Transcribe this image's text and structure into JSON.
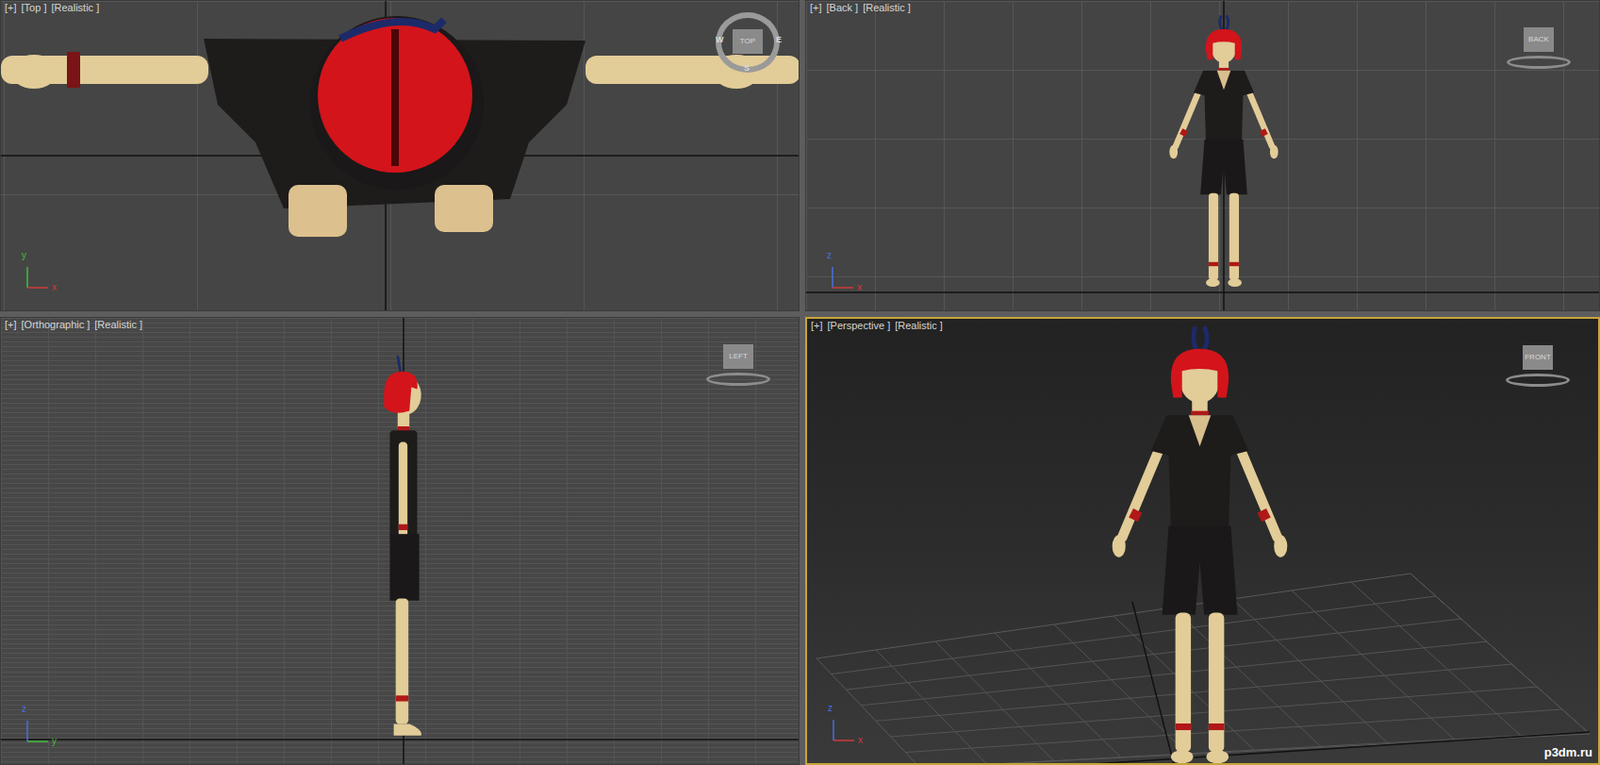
{
  "application": "3ds Max",
  "viewports": [
    {
      "kind": "top",
      "menus": [
        "[+]",
        "[Top ]",
        "[Realistic ]"
      ],
      "active": false,
      "cube": "TOP",
      "compass": [
        "W",
        "S",
        "E"
      ],
      "axes": [
        {
          "label": "y",
          "color": "#3fbf3f"
        },
        {
          "label": "x",
          "color": "#d03a3a"
        }
      ]
    },
    {
      "kind": "back",
      "menus": [
        "[+]",
        "[Back ]",
        "[Realistic ]"
      ],
      "active": false,
      "cube": "BACK",
      "compass": [],
      "axes": [
        {
          "label": "z",
          "color": "#4a6ee0"
        },
        {
          "label": "x",
          "color": "#d03a3a"
        }
      ]
    },
    {
      "kind": "side",
      "menus": [
        "[+]",
        "[Orthographic ]",
        "[Realistic ]"
      ],
      "active": false,
      "cube": "LEFT",
      "compass": [],
      "axes": [
        {
          "label": "z",
          "color": "#4a6ee0"
        },
        {
          "label": "y",
          "color": "#3fbf3f"
        }
      ]
    },
    {
      "kind": "perspective",
      "menus": [
        "[+]",
        "[Perspective ]",
        "[Realistic ]"
      ],
      "active": true,
      "cube": "FRONT",
      "compass": [],
      "axes": [
        {
          "label": "z",
          "color": "#4a6ee0"
        },
        {
          "label": "x",
          "color": "#d03a3a"
        }
      ]
    }
  ],
  "watermark": "p3dm.ru"
}
